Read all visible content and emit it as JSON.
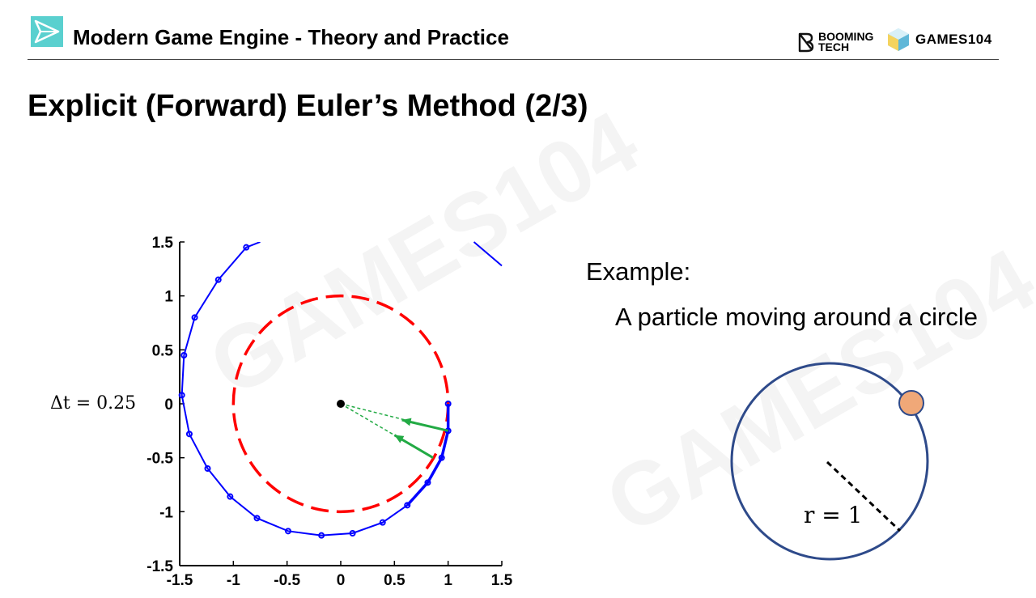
{
  "header": {
    "title": "Modern Game Engine - Theory and Practice",
    "brand_booming_line1": "BOOMING",
    "brand_booming_line2": "TECH",
    "brand_games": "GAMES104"
  },
  "slide": {
    "title": "Explicit (Forward) Euler’s Method (2/3)",
    "dt_label": "Δt = 0.25",
    "example_label": "Example:",
    "example_desc": "A particle moving around a circle",
    "r_label": "r = 1"
  },
  "watermark": "GAMES104",
  "colors": {
    "accent_logo": "#5ad0cf",
    "trajectory": "#0000ff",
    "exact_circle": "#ff0000",
    "velocity_arrow": "#22aa44",
    "diagram_circle": "#2e4a8a",
    "particle": "#f0a878"
  },
  "chart_data": {
    "type": "line",
    "xlim": [
      -1.5,
      1.5
    ],
    "ylim": [
      -1.5,
      1.5
    ],
    "x_ticks": [
      "-1.5",
      "-1",
      "-0.5",
      "0",
      "0.5",
      "1",
      "1.5"
    ],
    "y_ticks": [
      "1.5",
      "1",
      "0.5",
      "0",
      "-0.5",
      "-1",
      "-1.5"
    ],
    "x_tick_values": [
      -1.5,
      -1,
      -0.5,
      0,
      0.5,
      1,
      1.5
    ],
    "y_tick_values": [
      1.5,
      1,
      0.5,
      0,
      -0.5,
      -1,
      -1.5
    ],
    "grid": false,
    "series": [
      {
        "style": "blue line with dot markers",
        "points": [
          [
            1.0,
            0.0
          ],
          [
            1.0,
            -0.25
          ],
          [
            0.94,
            -0.5
          ],
          [
            0.81,
            -0.73
          ],
          [
            0.62,
            -0.94
          ],
          [
            0.39,
            -1.1
          ],
          [
            0.11,
            -1.2
          ],
          [
            -0.18,
            -1.22
          ],
          [
            -0.49,
            -1.18
          ],
          [
            -0.78,
            -1.06
          ],
          [
            -1.03,
            -0.86
          ],
          [
            -1.24,
            -0.6
          ],
          [
            -1.41,
            -0.28
          ],
          [
            -1.48,
            0.08
          ],
          [
            -1.46,
            0.45
          ],
          [
            -1.36,
            0.8
          ],
          [
            -1.14,
            1.15
          ],
          [
            -0.88,
            1.45
          ],
          [
            -0.75,
            1.5
          ]
        ]
      },
      {
        "style": "blue line segment",
        "points": [
          [
            1.24,
            1.5
          ],
          [
            1.5,
            1.28
          ]
        ]
      },
      {
        "style": "red dashed circle",
        "center": [
          0,
          0
        ],
        "radius": 1
      }
    ],
    "center_point": [
      0,
      0
    ],
    "arrows": [
      {
        "from": [
          1.0,
          -0.25
        ],
        "to": [
          0.57,
          -0.15
        ]
      },
      {
        "from": [
          0.86,
          -0.5
        ],
        "to": [
          0.5,
          -0.29
        ]
      }
    ],
    "dashed_guides": [
      {
        "from": [
          0,
          0
        ],
        "to": [
          1.0,
          -0.25
        ]
      },
      {
        "from": [
          0,
          0
        ],
        "to": [
          0.86,
          -0.5
        ]
      }
    ]
  },
  "diagram": {
    "radius_label": "r = 1"
  }
}
